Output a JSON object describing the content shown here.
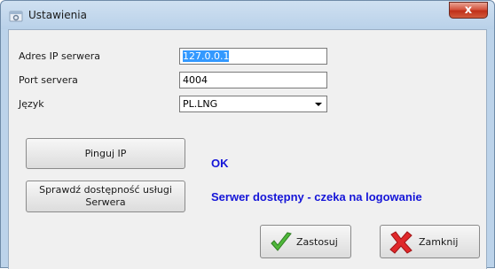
{
  "window": {
    "title": "Ustawienia",
    "close_label": "x"
  },
  "form": {
    "ip_label": "Adres IP serwera",
    "ip_value": "127.0.0.1",
    "port_label": "Port servera",
    "port_value": "4004",
    "language_label": "Język",
    "language_value": "PL.LNG"
  },
  "buttons": {
    "ping": "Pinguj IP",
    "check_line1": "Sprawdź dostępność usługi",
    "check_line2": "Serwera",
    "apply": "Zastosuj",
    "close": "Zamknij"
  },
  "status": {
    "ping_result": "OK",
    "service_result": "Serwer dostępny - czeka na logowanie"
  },
  "icons": {
    "app": "settings-icon",
    "apply": "green-checkmark-icon",
    "close": "red-x-icon"
  },
  "colors": {
    "status_text": "#1515d8",
    "title_bar": "#bcd3ea",
    "close_button": "#c0301a"
  }
}
